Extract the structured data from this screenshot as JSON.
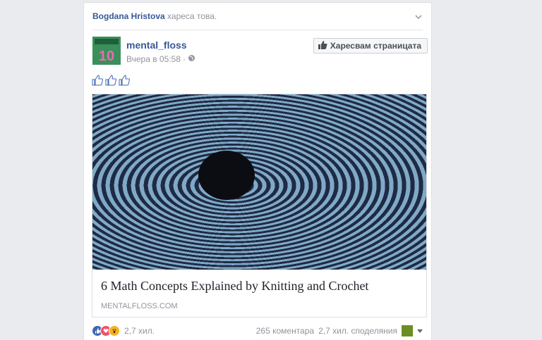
{
  "story": {
    "actor": "Bogdana Hristova",
    "verb": "хареса това."
  },
  "post": {
    "page_name": "mental_floss",
    "timestamp": "Вчера в 05:58",
    "privacy_icon": "globe-icon",
    "avatar_text": "10",
    "like_page_label": "Харесвам страницата",
    "thumbs_icons": [
      "thumbs-up-icon",
      "thumbs-up-icon",
      "thumbs-up-icon"
    ]
  },
  "attachment": {
    "title": "6 Math Concepts Explained by Knitting and Crochet",
    "domain": "MENTALFLOSS.COM"
  },
  "footer": {
    "reaction_icons": [
      "like-reaction-icon",
      "love-reaction-icon",
      "wow-reaction-icon"
    ],
    "reaction_count": "2,7 хил.",
    "comments": "265 коментара",
    "shares": "2,7 хил. споделяния"
  },
  "colors": {
    "link": "#365899",
    "meta": "#90949c",
    "like_blue": "#4267b2",
    "love_red": "#f25268",
    "wow_yellow": "#f7b125"
  }
}
